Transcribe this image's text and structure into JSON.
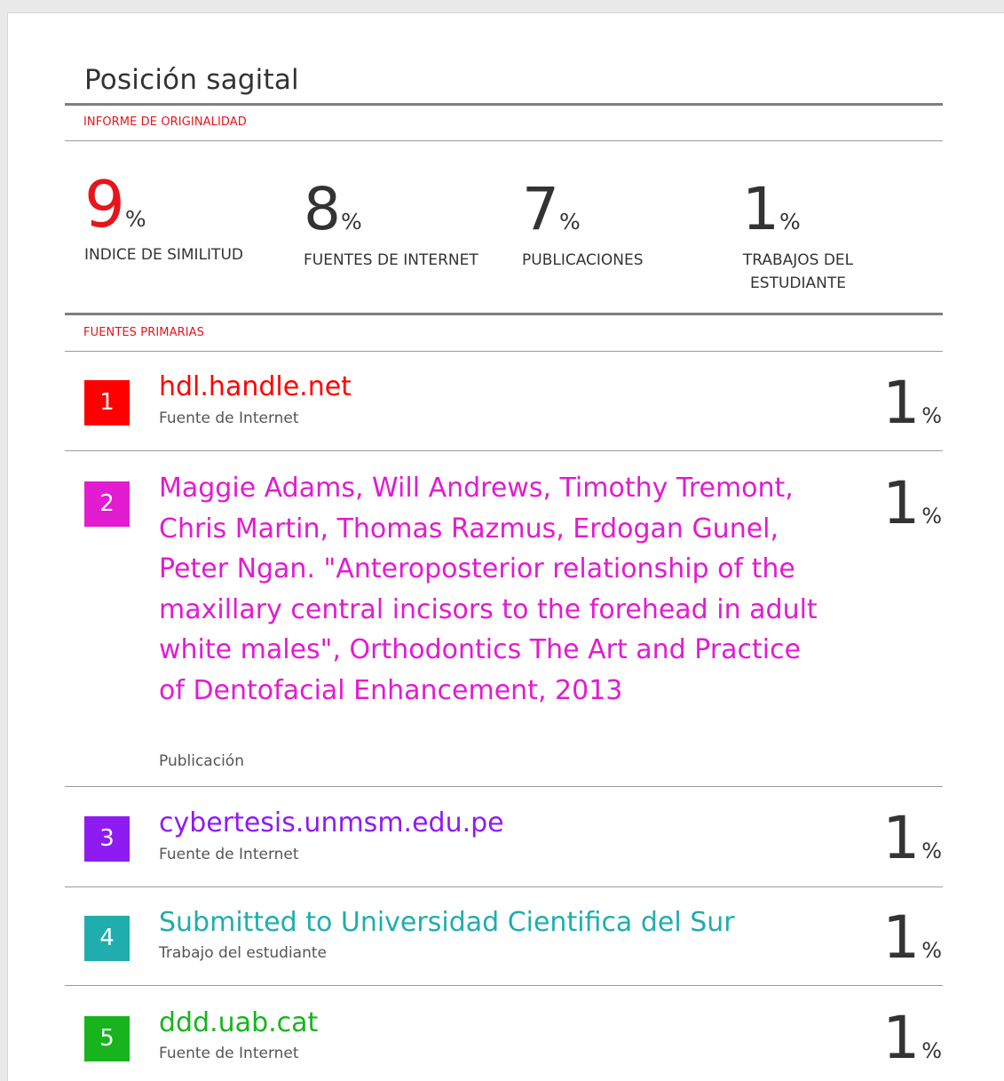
{
  "document": {
    "title": "Posición sagital",
    "originality_label": "INFORME DE ORIGINALIDAD",
    "primary_sources_label": "FUENTES PRIMARIAS"
  },
  "stats": [
    {
      "value": "9",
      "unit": "%",
      "label": "INDICE DE SIMILITUD",
      "color": "#e8141b"
    },
    {
      "value": "8",
      "unit": "%",
      "label": "FUENTES DE INTERNET",
      "color": "#333333"
    },
    {
      "value": "7",
      "unit": "%",
      "label": "PUBLICACIONES",
      "color": "#333333"
    },
    {
      "value": "1",
      "unit": "%",
      "label": "TRABAJOS DEL ESTUDIANTE",
      "color": "#333333"
    }
  ],
  "sources": [
    {
      "rank": "1",
      "title": "hdl.handle.net",
      "type": "Fuente de Internet",
      "value": "1",
      "unit": "%",
      "color": "#ff0000"
    },
    {
      "rank": "2",
      "title": "Maggie Adams, Will Andrews, Timothy Tremont, Chris Martin, Thomas Razmus, Erdogan Gunel, Peter Ngan. \"Anteroposterior relationship of the maxillary central incisors to the forehead in adult white males\", Orthodontics The Art and Practice of Dentofacial Enhancement, 2013",
      "type": "Publicación",
      "value": "1",
      "unit": "%",
      "color": "#e31bd1"
    },
    {
      "rank": "3",
      "title": "cybertesis.unmsm.edu.pe",
      "type": "Fuente de Internet",
      "value": "1",
      "unit": "%",
      "color": "#8e1cf2"
    },
    {
      "rank": "4",
      "title": "Submitted to Universidad Cientifica del Sur",
      "type": "Trabajo del estudiante",
      "value": "1",
      "unit": "%",
      "color": "#1fadad"
    },
    {
      "rank": "5",
      "title": "ddd.uab.cat",
      "type": "Fuente de Internet",
      "value": "1",
      "unit": "%",
      "color": "#17b41d"
    }
  ]
}
